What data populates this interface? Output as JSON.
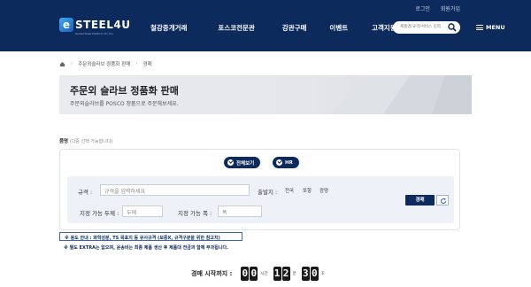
{
  "header": {
    "util_links": [
      "로그인",
      "회원가입"
    ],
    "logo_text": "STEEL4U",
    "logo_letter": "e",
    "logo_sub": "Global Steel Platform for You",
    "nav": [
      "철강중개거래",
      "포스코전문관",
      "강관구매",
      "이벤트",
      "고객지원"
    ],
    "search_placeholder": "제품명/규격/서비스 입력",
    "menu_label": "MENU"
  },
  "breadcrumb": {
    "items": [
      "주문외슬라브 정품화 판매",
      "경매"
    ]
  },
  "banner": {
    "title": "주문외 슬라브 정품화 판매",
    "subtitle": "주문외슬라브를 POSCO 정품으로 주문해보세요."
  },
  "product": {
    "label": "품명",
    "hint": "(다중 선택 가능합니다)",
    "chips": [
      "전체보기",
      "HR"
    ]
  },
  "filters": {
    "spec_label": "규격 :",
    "spec_placeholder": "규격을 입력하세요",
    "origin_label": "출발지 :",
    "origins": [
      "전국",
      "포항",
      "광양"
    ],
    "thickness_label": "지정 가능 두께 :",
    "thickness_placeholder": "두께",
    "width_label": "지정 가능 폭 :",
    "width_placeholder": "폭",
    "search_button": "경매"
  },
  "notes": {
    "note1": "※ 용도 안내 : 화학성분, TS 목표치 등 유사규격 (보증X, 규격구분을 위한 참고치)",
    "note2": "※ 별도 EXTRA는 없으며, 운송비는 최종 제품 생산 후 제품대 전금과 함께 부과됩니다."
  },
  "timer": {
    "label": "경매 시작까지 :",
    "hours": "00",
    "hours_unit": "시간",
    "minutes": "12",
    "minutes_unit": "분",
    "seconds": "30",
    "seconds_unit": "초"
  },
  "colors": {
    "navy": "#0c2a5c",
    "panel_bg": "#eef2f8"
  }
}
